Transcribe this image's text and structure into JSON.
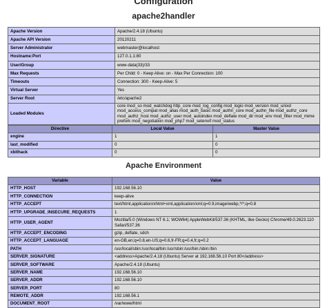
{
  "headings": {
    "title": "Configuration",
    "module": "apache2handler",
    "environment": "Apache Environment"
  },
  "config": [
    {
      "name": "Apache Version",
      "value": "Apache/2.4.18 (Ubuntu)"
    },
    {
      "name": "Apache API Version",
      "value": "20120211"
    },
    {
      "name": "Server Administrator",
      "value": "webmaster@localhost"
    },
    {
      "name": "Hostname:Port",
      "value": "127.0.1.1:80"
    },
    {
      "name": "User/Group",
      "value": "www-data(33)/33"
    },
    {
      "name": "Max Requests",
      "value": "Per Child: 0 - Keep Alive: on - Max Per Connection: 100"
    },
    {
      "name": "Timeouts",
      "value": "Connection: 300 - Keep-Alive: 5"
    },
    {
      "name": "Virtual Server",
      "value": "Yes"
    },
    {
      "name": "Server Root",
      "value": "/etc/apache2"
    },
    {
      "name": "Loaded Modules",
      "value": "core mod_so mod_watchdog http_core mod_log_config mod_logio mod_version mod_unixd mod_access_compat mod_alias mod_auth_basic mod_authn_core mod_authn_file mod_authz_core mod_authz_host mod_authz_user mod_autoindex mod_deflate mod_dir mod_env mod_filter mod_mime prefork mod_negotiation mod_php7 mod_setenvif mod_status"
    }
  ],
  "directives": {
    "headers": [
      "Directive",
      "Local Value",
      "Master Value"
    ],
    "rows": [
      {
        "name": "engine",
        "local": "1",
        "master": "1"
      },
      {
        "name": "last_modified",
        "local": "0",
        "master": "0"
      },
      {
        "name": "xbithack",
        "local": "0",
        "master": "0"
      }
    ]
  },
  "env": {
    "headers": [
      "Variable",
      "Value"
    ],
    "rows": [
      {
        "name": "HTTP_HOST",
        "value": "192.168.56.10"
      },
      {
        "name": "HTTP_CONNECTION",
        "value": "keep-alive"
      },
      {
        "name": "HTTP_ACCEPT",
        "value": "text/html,application/xhtml+xml,application/xml;q=0.9,image/webp,*/*;q=0.8"
      },
      {
        "name": "HTTP_UPGRADE_INSECURE_REQUESTS",
        "value": "1"
      },
      {
        "name": "HTTP_USER_AGENT",
        "value": "Mozilla/5.0 (Windows NT 6.1; WOW64) AppleWebKit/537.36 (KHTML, like Gecko) Chrome/49.0.2623.110 Safari/537.36"
      },
      {
        "name": "HTTP_ACCEPT_ENCODING",
        "value": "gzip, deflate, sdch"
      },
      {
        "name": "HTTP_ACCEPT_LANGUAGE",
        "value": "en-GB,en;q=0.8,en-US;q=0.6,fr-FR;q=0.4,fr;q=0.2"
      },
      {
        "name": "PATH",
        "value": "/usr/local/sbin:/usr/local/bin:/usr/sbin:/usr/bin:/sbin:/bin"
      },
      {
        "name": "SERVER_SIGNATURE",
        "value": "<address>Apache/2.4.18 (Ubuntu) Server at 192.168.56.10 Port 80</address>"
      },
      {
        "name": "SERVER_SOFTWARE",
        "value": "Apache/2.4.18 (Ubuntu)"
      },
      {
        "name": "SERVER_NAME",
        "value": "192.168.56.10"
      },
      {
        "name": "SERVER_ADDR",
        "value": "192.168.56.10"
      },
      {
        "name": "SERVER_PORT",
        "value": "80"
      },
      {
        "name": "REMOTE_ADDR",
        "value": "192.168.56.1"
      },
      {
        "name": "DOCUMENT_ROOT",
        "value": "/var/www/html"
      }
    ]
  },
  "colors": {
    "header_bg": "#9999cc",
    "name_bg": "#ccccff",
    "value_bg": "#dddddd"
  }
}
